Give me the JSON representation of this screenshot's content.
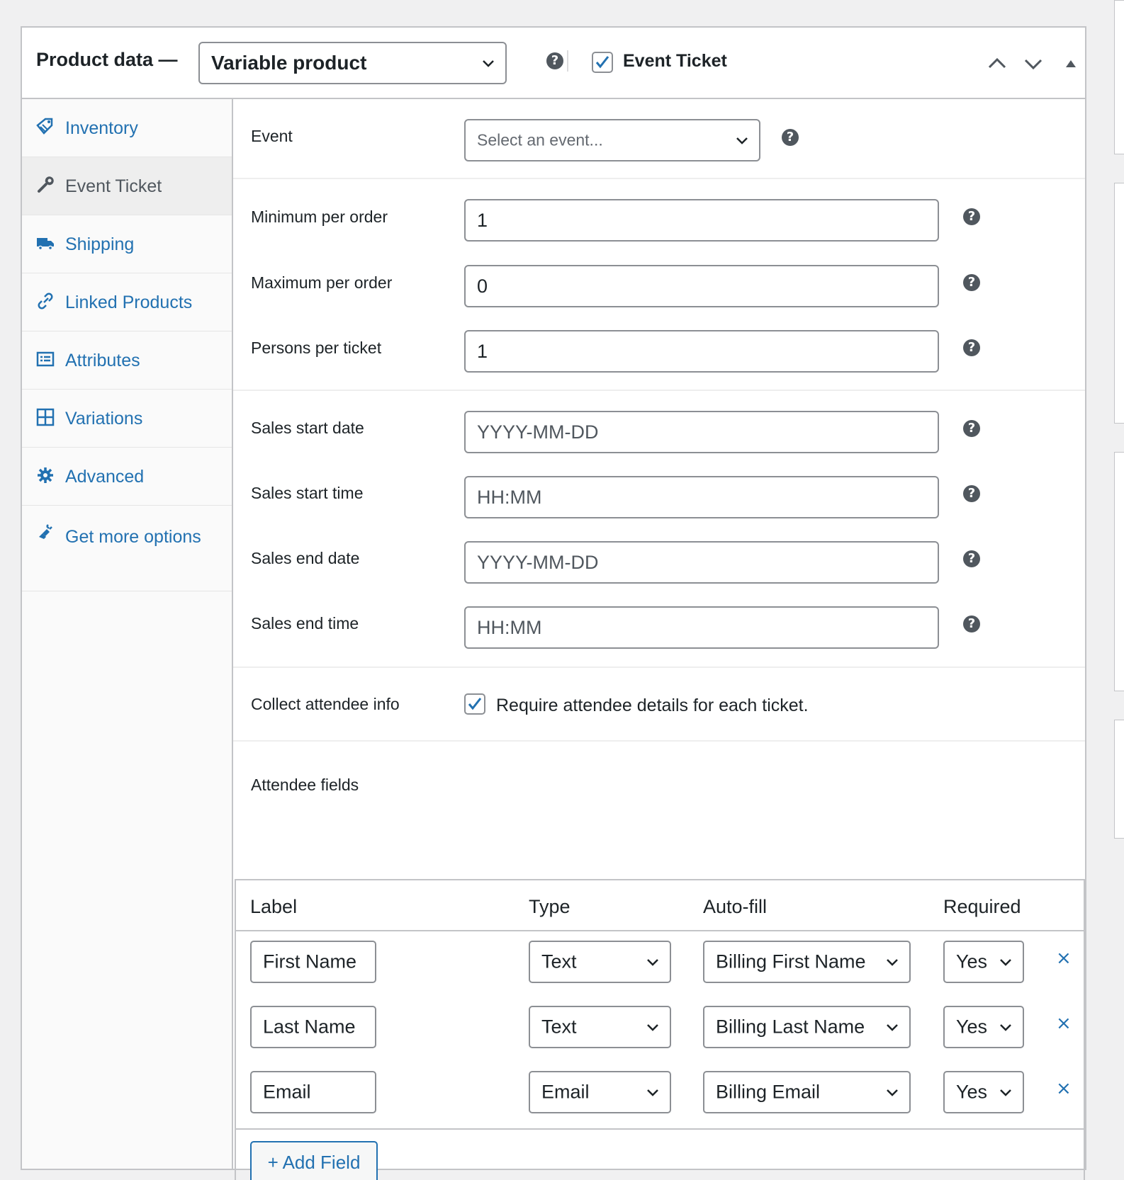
{
  "header": {
    "title": "Product data —",
    "product_type": "Variable product",
    "event_ticket_label": "Event Ticket",
    "event_ticket_checked": true
  },
  "sidebar": {
    "items": [
      {
        "label": "Inventory",
        "icon": "tag-icon",
        "active": false
      },
      {
        "label": "Event Ticket",
        "icon": "wrench-icon",
        "active": true
      },
      {
        "label": "Shipping",
        "icon": "truck-icon",
        "active": false
      },
      {
        "label": "Linked Products",
        "icon": "link-icon",
        "active": false
      },
      {
        "label": "Attributes",
        "icon": "list-icon",
        "active": false
      },
      {
        "label": "Variations",
        "icon": "grid-icon",
        "active": false
      },
      {
        "label": "Advanced",
        "icon": "gear-icon",
        "active": false
      },
      {
        "label": "Get more options",
        "icon": "plugin-icon",
        "active": false
      }
    ]
  },
  "fields": {
    "event": {
      "label": "Event",
      "placeholder": "Select an event..."
    },
    "min_per_order": {
      "label": "Minimum per order",
      "value": "1"
    },
    "max_per_order": {
      "label": "Maximum per order",
      "value": "0"
    },
    "persons_per_ticket": {
      "label": "Persons per ticket",
      "value": "1"
    },
    "sales_start_date": {
      "label": "Sales start date",
      "placeholder": "YYYY-MM-DD"
    },
    "sales_start_time": {
      "label": "Sales start time",
      "placeholder": "HH:MM"
    },
    "sales_end_date": {
      "label": "Sales end date",
      "placeholder": "YYYY-MM-DD"
    },
    "sales_end_time": {
      "label": "Sales end time",
      "placeholder": "HH:MM"
    },
    "collect_attendee": {
      "label": "Collect attendee info",
      "checkbox_text": "Require attendee details for each ticket.",
      "checked": true
    }
  },
  "attendee": {
    "section_label": "Attendee fields",
    "columns": [
      "Label",
      "Type",
      "Auto-fill",
      "Required"
    ],
    "rows": [
      {
        "label": "First Name",
        "type": "Text",
        "autofill": "Billing First Name",
        "required": "Yes",
        "remove": "×"
      },
      {
        "label": "Last Name",
        "type": "Text",
        "autofill": "Billing Last Name",
        "required": "Yes",
        "remove": "×"
      },
      {
        "label": "Email",
        "type": "Email",
        "autofill": "Billing Email",
        "required": "Yes",
        "remove": "×"
      }
    ],
    "add_button": "+ Add Field"
  },
  "colors": {
    "link": "#2271b1",
    "border": "#c3c4c7",
    "active_tab": "#eeeeee",
    "help_icon": "#50575e"
  }
}
